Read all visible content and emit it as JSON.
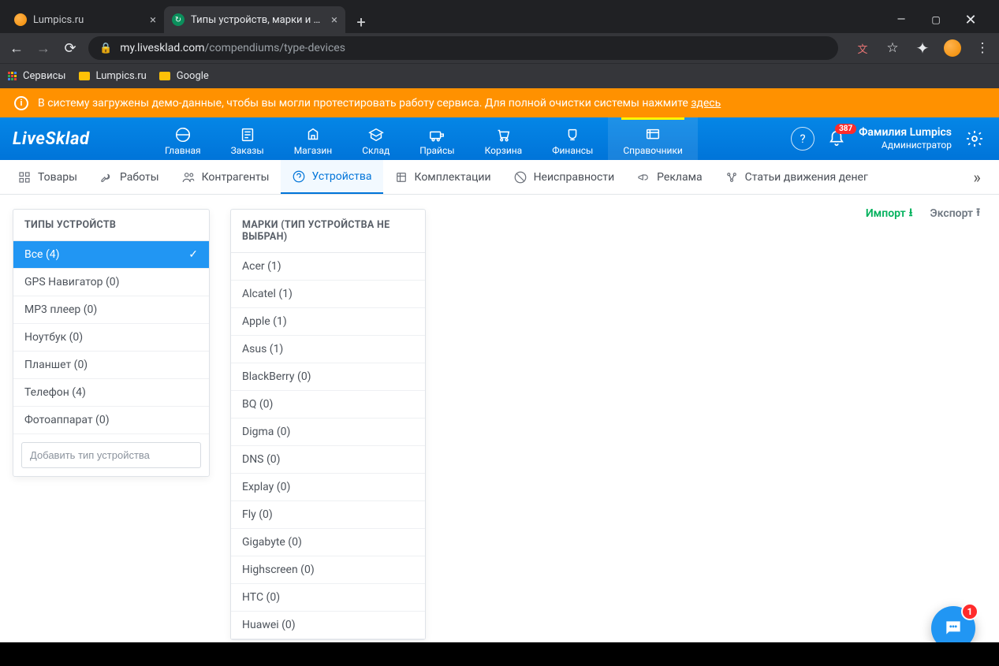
{
  "browser": {
    "tabs": [
      {
        "title": "Lumpics.ru",
        "active": false
      },
      {
        "title": "Типы устройств, марки и моде…",
        "active": true
      }
    ],
    "url_host": "my.livesklad.com",
    "url_path": "/compendiums/type-devices",
    "bookmarks_label_apps": "Сервисы",
    "bookmarks": [
      "Lumpics.ru",
      "Google"
    ]
  },
  "notice": {
    "text_a": "В систему загружены демо-данные, чтобы вы могли протестировать работу сервиса. Для полной очистки системы нажмите ",
    "link": "здесь"
  },
  "brand": "LiveSklad",
  "topnav": [
    {
      "label": "Главная"
    },
    {
      "label": "Заказы"
    },
    {
      "label": "Магазин"
    },
    {
      "label": "Склад"
    },
    {
      "label": "Прайсы"
    },
    {
      "label": "Корзина"
    },
    {
      "label": "Финансы"
    },
    {
      "label": "Справочники",
      "active": true
    }
  ],
  "bell_badge": "387",
  "user": {
    "name": "Фамилия Lumpics",
    "role": "Администратор"
  },
  "subnav": [
    {
      "label": "Товары"
    },
    {
      "label": "Работы"
    },
    {
      "label": "Контрагенты"
    },
    {
      "label": "Устройства",
      "active": true
    },
    {
      "label": "Комплектации"
    },
    {
      "label": "Неисправности"
    },
    {
      "label": "Реклама"
    },
    {
      "label": "Статьи движения денег"
    }
  ],
  "types_panel": {
    "title": "ТИПЫ УСТРОЙСТВ",
    "items": [
      {
        "label": "Все (4)",
        "selected": true
      },
      {
        "label": "GPS Навигатор (0)"
      },
      {
        "label": "MP3 плеер (0)"
      },
      {
        "label": "Ноутбук (0)"
      },
      {
        "label": "Планшет (0)"
      },
      {
        "label": "Телефон (4)"
      },
      {
        "label": "Фотоаппарат (0)"
      }
    ],
    "add_placeholder": "Добавить тип устройства"
  },
  "brands_panel": {
    "title": "МАРКИ (ТИП УСТРОЙСТВА НЕ ВЫБРАН)",
    "items": [
      {
        "label": "Acer (1)"
      },
      {
        "label": "Alcatel (1)"
      },
      {
        "label": "Apple (1)"
      },
      {
        "label": "Asus (1)"
      },
      {
        "label": "BlackBerry (0)"
      },
      {
        "label": "BQ (0)"
      },
      {
        "label": "Digma (0)"
      },
      {
        "label": "DNS (0)"
      },
      {
        "label": "Explay (0)"
      },
      {
        "label": "Fly (0)"
      },
      {
        "label": "Gigabyte (0)"
      },
      {
        "label": "Highscreen (0)"
      },
      {
        "label": "HTC (0)"
      },
      {
        "label": "Huawei (0)"
      }
    ]
  },
  "io": {
    "import": "Импорт",
    "export": "Экспорт"
  },
  "chat_badge": "1"
}
